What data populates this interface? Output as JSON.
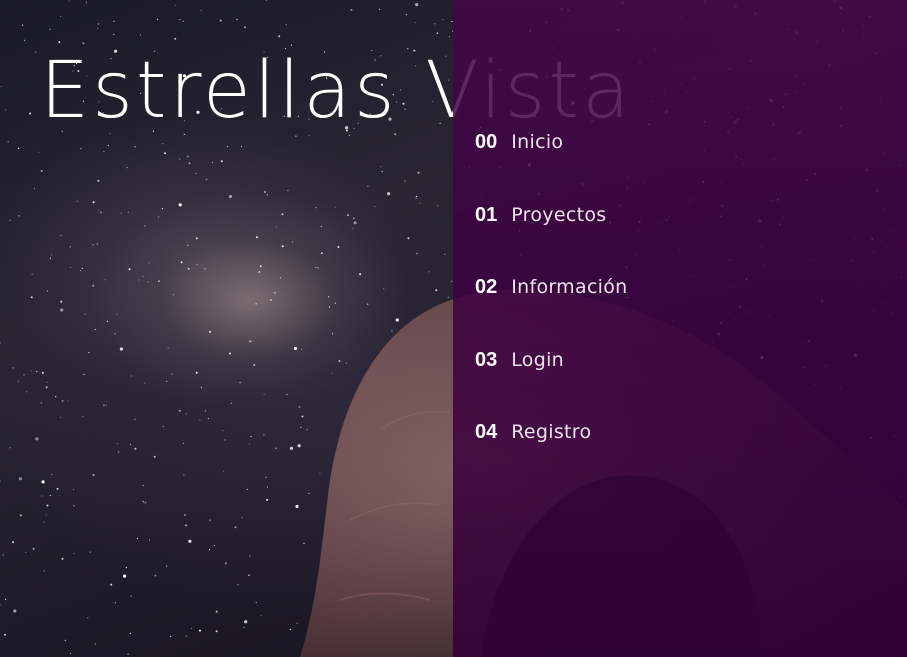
{
  "site": {
    "title": "Estrellas Vista"
  },
  "menu": {
    "items": [
      {
        "number": "00",
        "label": "Inicio"
      },
      {
        "number": "01",
        "label": "Proyectos"
      },
      {
        "number": "02",
        "label": "Información"
      },
      {
        "number": "03",
        "label": "Login"
      },
      {
        "number": "04",
        "label": "Registro"
      }
    ]
  },
  "colors": {
    "overlay": "#3c0040",
    "title": "#ffffff",
    "menu_text": "#efe2ef"
  }
}
